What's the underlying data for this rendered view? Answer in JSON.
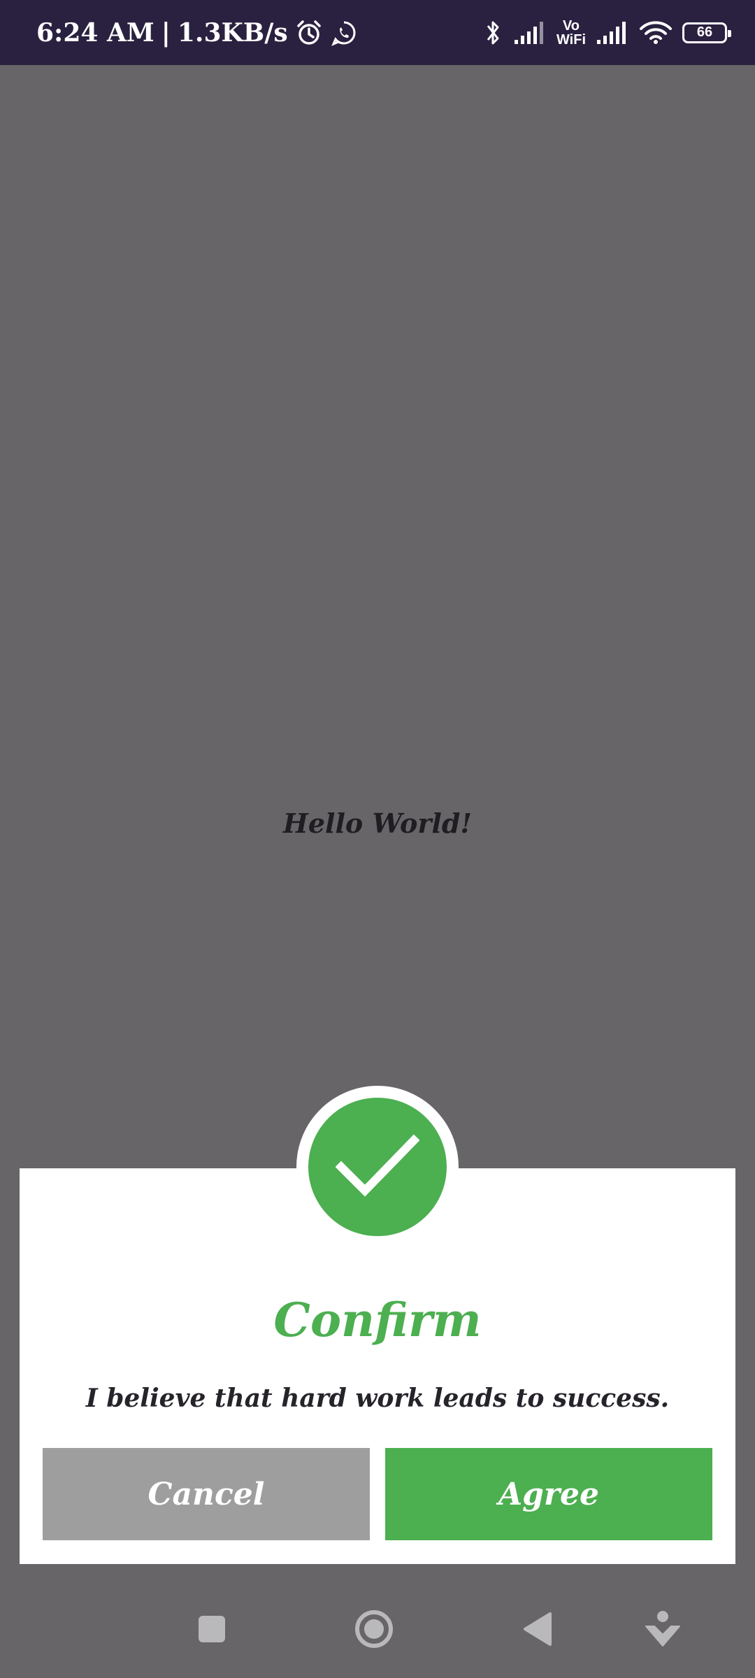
{
  "status_bar": {
    "time": "6:24 AM",
    "separator": "|",
    "network_speed": "1.3KB/s",
    "vowifi_top": "Vo",
    "vowifi_bottom": "WiFi",
    "battery_level": "66",
    "icons": [
      "alarm-icon",
      "whatsapp-icon",
      "bluetooth-icon",
      "signal-icon",
      "vowifi-icon",
      "signal-icon",
      "wifi-icon",
      "battery-icon"
    ]
  },
  "main": {
    "center_text": "Hello World!"
  },
  "dialog": {
    "icon": "checkmark-icon",
    "title": "Confirm",
    "message": "I believe that hard work leads to success.",
    "cancel_label": "Cancel",
    "agree_label": "Agree"
  },
  "nav_bar": {
    "icons": [
      "recent-apps-icon",
      "home-icon",
      "back-icon",
      "accessibility-icon"
    ]
  },
  "colors": {
    "status_bar_bg": "#2a2140",
    "screen_dim": "#676568",
    "accent_green": "#4caf50",
    "cancel_gray": "#9e9e9e",
    "dialog_bg": "#ffffff"
  }
}
